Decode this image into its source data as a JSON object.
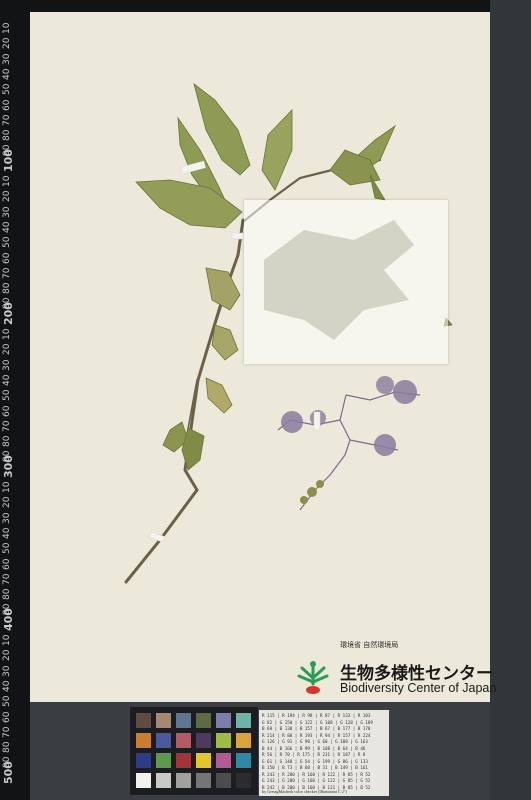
{
  "ruler": {
    "labels": [
      "10",
      "20",
      "30",
      "40",
      "50",
      "60",
      "70",
      "80",
      "90",
      "100",
      "10",
      "20",
      "30",
      "40",
      "50",
      "60",
      "70",
      "80",
      "90",
      "200",
      "10",
      "20",
      "30",
      "40",
      "50",
      "60",
      "70",
      "80",
      "90",
      "300",
      "10",
      "20",
      "30",
      "40",
      "50",
      "60",
      "70",
      "80",
      "90",
      "400",
      "10",
      "20",
      "30",
      "40",
      "50",
      "60",
      "70",
      "80",
      "90",
      "500"
    ]
  },
  "institution": {
    "ministry_jp": "環境省 自然環境局",
    "center_jp": "生物多様性センター",
    "center_en": "Biodiversity Center of Japan"
  },
  "color_checker": {
    "colors": [
      "#5f4b3f",
      "#a78774",
      "#5e7593",
      "#5d6a44",
      "#7b7daa",
      "#6db4a7",
      "#c97d31",
      "#4b5a9c",
      "#b35a63",
      "#4d3a5e",
      "#9fbb45",
      "#d9a43b",
      "#2e3b86",
      "#5d9a4e",
      "#a3343a",
      "#e2c52d",
      "#b25b93",
      "#2f88a6",
      "#f1f0ec",
      "#c9c9c8",
      "#a0a09f",
      "#747574",
      "#4c4c4d",
      "#2c2c2e"
    ],
    "credit": "by GretagMacbeth color checker (Illuminant C 2°)"
  },
  "color_table": {
    "rows": [
      "R 115 | R 194 | R  98 | R  87 | R 133 | R 103",
      "G  82 | G 150 | G 122 | G 108 | G 128 | G 189",
      "B  68 | B 130 | B 157 | B  67 | B 177 | B 170",
      "R 214 | R  80 | R 193 | R  94 | R 157 | R 224",
      "G 126 | G  91 | G  90 | G  60 | G 188 | G 163",
      "B  44 | B 166 | B  99 | B 108 | B  64 | B  46",
      "R  56 | R  70 | R 175 | R 231 | R 187 | R   8",
      "G  61 | G 148 | G  54 | G 199 | G  86 | G 133",
      "B 150 | B  73 | B  60 | B  31 | B 149 | B 161",
      "R 243 | R 200 | R 160 | R 122 | R  85 | R  52",
      "G 243 | G 200 | G 160 | G 122 | G  85 | G  52",
      "B 242 | B 200 | B 160 | B 121 | B  85 | B  52"
    ]
  }
}
